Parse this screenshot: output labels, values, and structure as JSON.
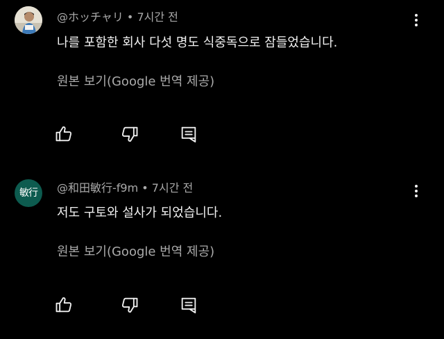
{
  "comments": [
    {
      "author": "@ホッチャリ",
      "separator": " • ",
      "time": "7시간 전",
      "text": "나를 포함한 회사 다섯 명도 식중독으로 잠들었습니다.",
      "translate_link": "원본 보기(Google 번역 제공)",
      "avatar_text": ""
    },
    {
      "author": "@和田敏行-f9m",
      "separator": " • ",
      "time": "7시간 전",
      "text": "저도 구토와 설사가 되었습니다.",
      "translate_link": "원본 보기(Google 번역 제공)",
      "avatar_text": "敏行",
      "avatar_color": "#0d5b4f"
    }
  ],
  "icons": {
    "like": "thumbs-up-icon",
    "dislike": "thumbs-down-icon",
    "reply": "reply-icon",
    "more": "more-vert-icon"
  },
  "colors": {
    "background": "#000000",
    "primary_text": "#f1f1f1",
    "secondary_text": "#aaaaaa"
  }
}
